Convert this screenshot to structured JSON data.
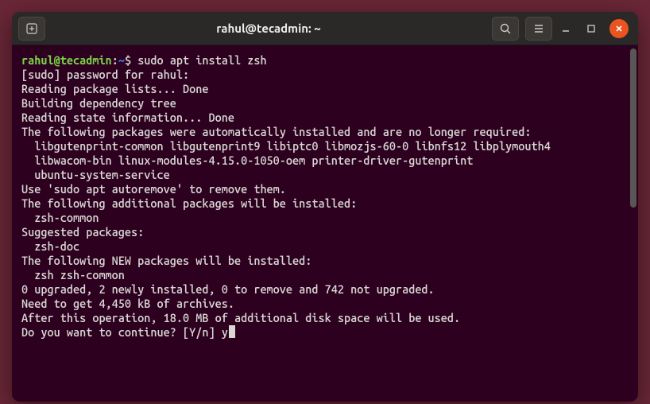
{
  "titlebar": {
    "title": "rahul@tecadmin: ~"
  },
  "prompt": {
    "user_host": "rahul@tecadmin",
    "sep": ":",
    "path": "~",
    "dollar": "$",
    "command": "sudo apt install zsh"
  },
  "output": {
    "l01": "[sudo] password for rahul:",
    "l02": "Reading package lists... Done",
    "l03": "Building dependency tree",
    "l04": "Reading state information... Done",
    "l05": "The following packages were automatically installed and are no longer required:",
    "l06": "  libgutenprint-common libgutenprint9 libiptc0 libmozjs-60-0 libnfs12 libplymouth4",
    "l07": "  libwacom-bin linux-modules-4.15.0-1050-oem printer-driver-gutenprint",
    "l08": "  ubuntu-system-service",
    "l09": "Use 'sudo apt autoremove' to remove them.",
    "l10": "The following additional packages will be installed:",
    "l11": "  zsh-common",
    "l12": "Suggested packages:",
    "l13": "  zsh-doc",
    "l14": "The following NEW packages will be installed:",
    "l15": "  zsh zsh-common",
    "l16": "0 upgraded, 2 newly installed, 0 to remove and 742 not upgraded.",
    "l17": "Need to get 4,450 kB of archives.",
    "l18": "After this operation, 18.0 MB of additional disk space will be used.",
    "l19_q": "Do you want to continue? [Y/n] ",
    "l19_a": "y"
  }
}
